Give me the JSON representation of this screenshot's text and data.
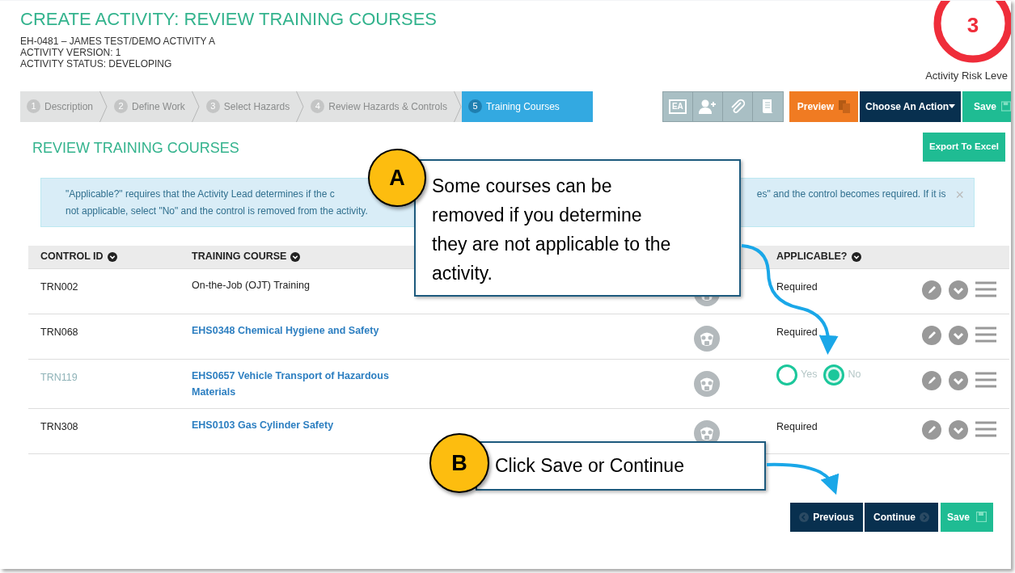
{
  "header": {
    "title": "CREATE ACTIVITY: REVIEW TRAINING COURSES",
    "lines": [
      "EH-0481 – JAMES TEST/DEMO ACTIVITY A",
      "ACTIVITY VERSION: 1",
      "ACTIVITY STATUS: DEVELOPING"
    ],
    "risk_level": "3",
    "risk_label": "Activity Risk Leve"
  },
  "steps": [
    {
      "number": "1",
      "label": "Description",
      "selected": false
    },
    {
      "number": "2",
      "label": "Define Work",
      "selected": false
    },
    {
      "number": "3",
      "label": "Select Hazards",
      "selected": false
    },
    {
      "number": "4",
      "label": "Review Hazards & Controls",
      "selected": false
    },
    {
      "number": "5",
      "label": "Training Courses",
      "selected": true
    }
  ],
  "toolbar": {
    "ea_label": "EA",
    "preview": "Preview",
    "action": "Choose An Action",
    "save": "Save"
  },
  "section": {
    "title": "REVIEW TRAINING COURSES",
    "export": "Export To Excel"
  },
  "notice": {
    "left_lines": [
      "\"Applicable?\" requires that the Activity Lead determines if the c",
      "not applicable, select \"No\" and the control is removed from the activity."
    ],
    "right_line": "es\" and the control becomes required. If it is",
    "close": "×"
  },
  "table": {
    "columns": [
      "CONTROL ID",
      "TRAINING COURSE",
      "APPLICABLE?"
    ],
    "rows": [
      {
        "control_id": "TRN002",
        "course": "On-the-Job (OJT) Training",
        "link": false,
        "dimmed": false,
        "applicable": {
          "kind": "text",
          "text": "Required"
        }
      },
      {
        "control_id": "TRN068",
        "course": "EHS0348 Chemical Hygiene and Safety",
        "link": true,
        "dimmed": false,
        "applicable": {
          "kind": "text",
          "text": "Required"
        }
      },
      {
        "control_id": "TRN119",
        "course": "EHS0657 Vehicle Transport of Hazardous Materials",
        "link": true,
        "dimmed": true,
        "applicable": {
          "kind": "choice",
          "options": [
            {
              "label": "Yes",
              "selected": false
            },
            {
              "label": "No",
              "selected": true
            }
          ]
        }
      },
      {
        "control_id": "TRN308",
        "course": "EHS0103 Gas Cylinder Safety",
        "link": true,
        "dimmed": false,
        "applicable": {
          "kind": "text",
          "text": "Required"
        }
      }
    ]
  },
  "footer_buttons": {
    "previous": "Previous",
    "continue": "Continue",
    "save": "Save"
  },
  "callouts": [
    {
      "letter": "A",
      "lines": [
        "Some courses can be",
        "removed if you determine",
        "they are not applicable to the",
        "activity."
      ]
    },
    {
      "letter": "B",
      "lines": [
        "Click Save or Continue"
      ]
    }
  ]
}
